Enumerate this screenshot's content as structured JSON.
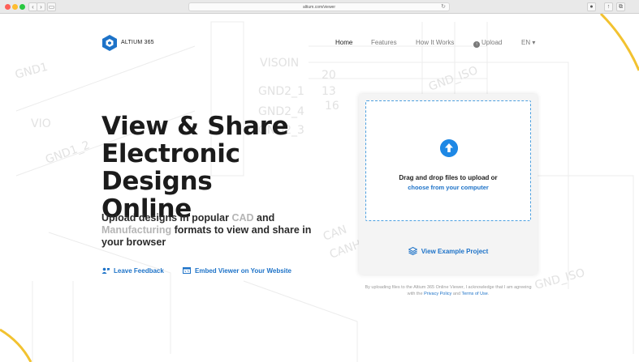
{
  "browser": {
    "url": "altium.com/viewer",
    "back_glyph": "‹",
    "forward_glyph": "›"
  },
  "header": {
    "logo_text": "ALTIUM 365",
    "nav": {
      "home": "Home",
      "features": "Features",
      "how_it_works": "How It Works",
      "upload": "Upload",
      "language": "EN ▾"
    }
  },
  "hero": {
    "title_line1": "View & Share",
    "title_line2": "Electronic Designs",
    "title_line3": "Online",
    "subtitle_part1": "Upload designs in popular ",
    "subtitle_cad": "CAD",
    "subtitle_part2": " and ",
    "subtitle_manufacturing": "Manufacturing",
    "subtitle_part3": " formats to view and share in your browser",
    "leave_feedback": "Leave Feedback",
    "embed_viewer": "Embed Viewer on Your Website"
  },
  "upload_card": {
    "drop_text": "Drag and drop files to upload or",
    "drop_link": "choose from your computer",
    "example_project": "View Example Project"
  },
  "legal": {
    "text_part1": "By uploading files to the Altium 365 Online Viewer, I acknowledge that I am agreeing with the ",
    "privacy": "Privacy Policy",
    "and": " and ",
    "terms": "Terms of Use",
    "period": "."
  },
  "background_labels": {
    "visoin": "VISOIN",
    "gnd2_1": "GND2_1",
    "gnd2_4": "GND2_4",
    "gnd2_3": "GND2_3",
    "n20": "20",
    "n13": "13",
    "n16": "16",
    "vio": "VIO",
    "gnd1_2": "GND1_2",
    "can_1": "CAN",
    "can_2": "CANH",
    "gnd_iso": "GND_ISO",
    "gnd_iso_2": "GND_ISO",
    "gnd1": "GND1"
  },
  "colors": {
    "accent": "#1e73c8",
    "accent_bright": "#1e88e5",
    "logo_blue": "#1e73c8",
    "yellow_curve": "#f2c230"
  },
  "icons": {
    "logo": "altium-hexagon-icon",
    "upload": "upload-circle-icon",
    "feedback": "feedback-person-icon",
    "embed": "embed-window-icon",
    "drop": "arrow-up-circle-icon",
    "example": "layers-icon"
  }
}
